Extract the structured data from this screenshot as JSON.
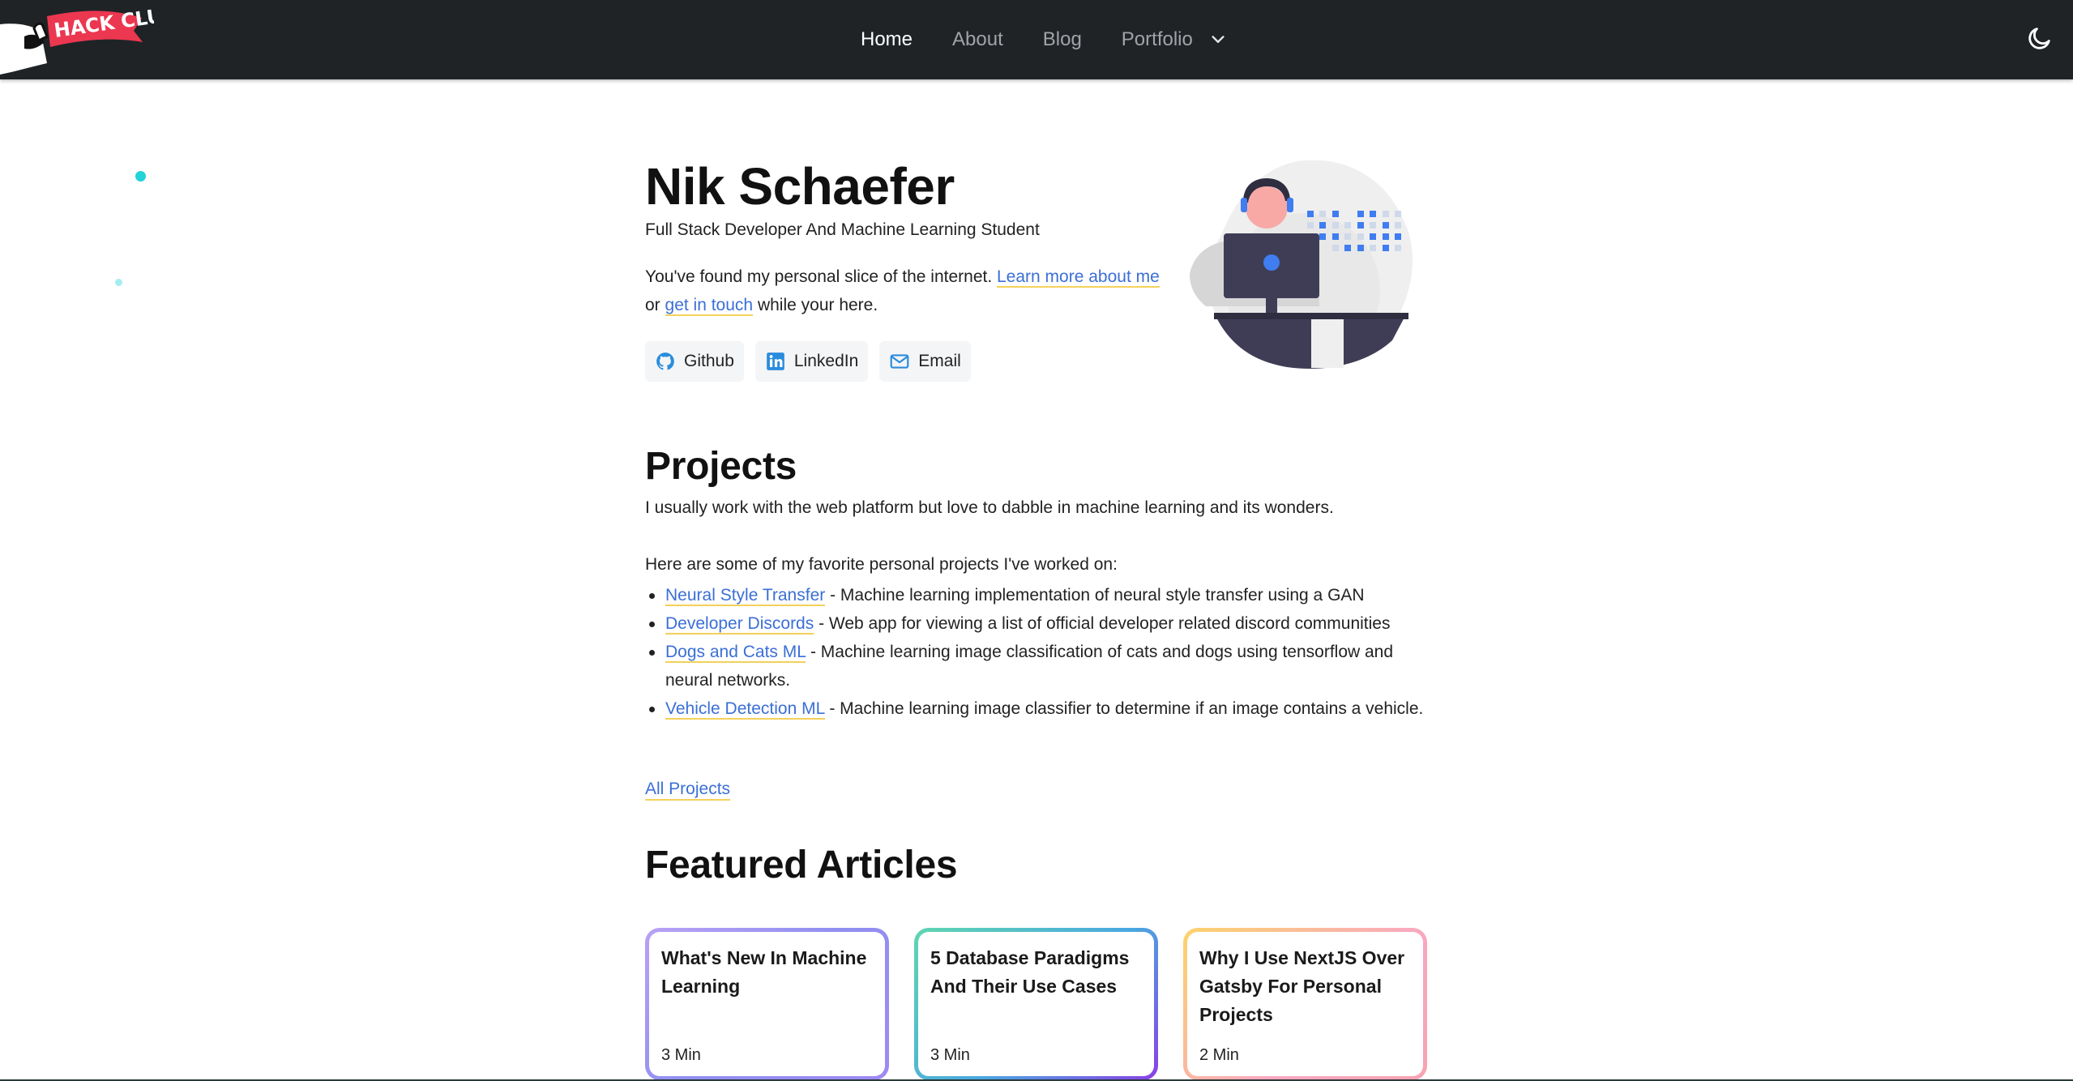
{
  "nav": {
    "brand": "HACK CLUB",
    "links": [
      "Home",
      "About",
      "Blog",
      "Portfolio"
    ],
    "active": "Home",
    "icons": {
      "dropdown": "chevron-down-icon",
      "theme": "moon-icon"
    }
  },
  "hero": {
    "name": "Nik Schaefer",
    "subtitle": "Full Stack Developer And Machine Learning Student",
    "intro_before": "You've found my personal slice of the internet. ",
    "learn_more": "Learn more about me",
    "intro_or": " or ",
    "get_in_touch": "get in touch",
    "intro_after": " while your here.",
    "social": [
      {
        "label": "Github",
        "icon": "github-icon"
      },
      {
        "label": "LinkedIn",
        "icon": "linkedin-icon"
      },
      {
        "label": "Email",
        "icon": "mail-icon"
      }
    ]
  },
  "projects": {
    "title": "Projects",
    "intro": "I usually work with the web platform but love to dabble in machine learning and its wonders.",
    "lead": "Here are some of my favorite personal projects I've worked on:",
    "items": [
      {
        "name": "Neural Style Transfer",
        "desc": " - Machine learning implementation of neural style transfer using a GAN"
      },
      {
        "name": "Developer Discords",
        "desc": " - Web app for viewing a list of official developer related discord communities"
      },
      {
        "name": "Dogs and Cats ML",
        "desc": " - Machine learning image classification of cats and dogs using tensorflow and neural networks."
      },
      {
        "name": "Vehicle Detection ML",
        "desc": " - Machine learning image classifier to determine if an image contains a vehicle."
      }
    ],
    "all_link": "All Projects"
  },
  "featured": {
    "title": "Featured Articles",
    "articles": [
      {
        "title": "What's New In Machine Learning",
        "time": "3 Min"
      },
      {
        "title": "5 Database Paradigms And Their Use Cases",
        "time": "3 Min"
      },
      {
        "title": "Why I Use NextJS Over Gatsby For Personal Projects",
        "time": "2 Min"
      }
    ]
  },
  "colors": {
    "navbar": "#202326",
    "link": "#3b6fd6",
    "link_underline": "#f3d15a",
    "accent_dot": "#22d3d8"
  }
}
